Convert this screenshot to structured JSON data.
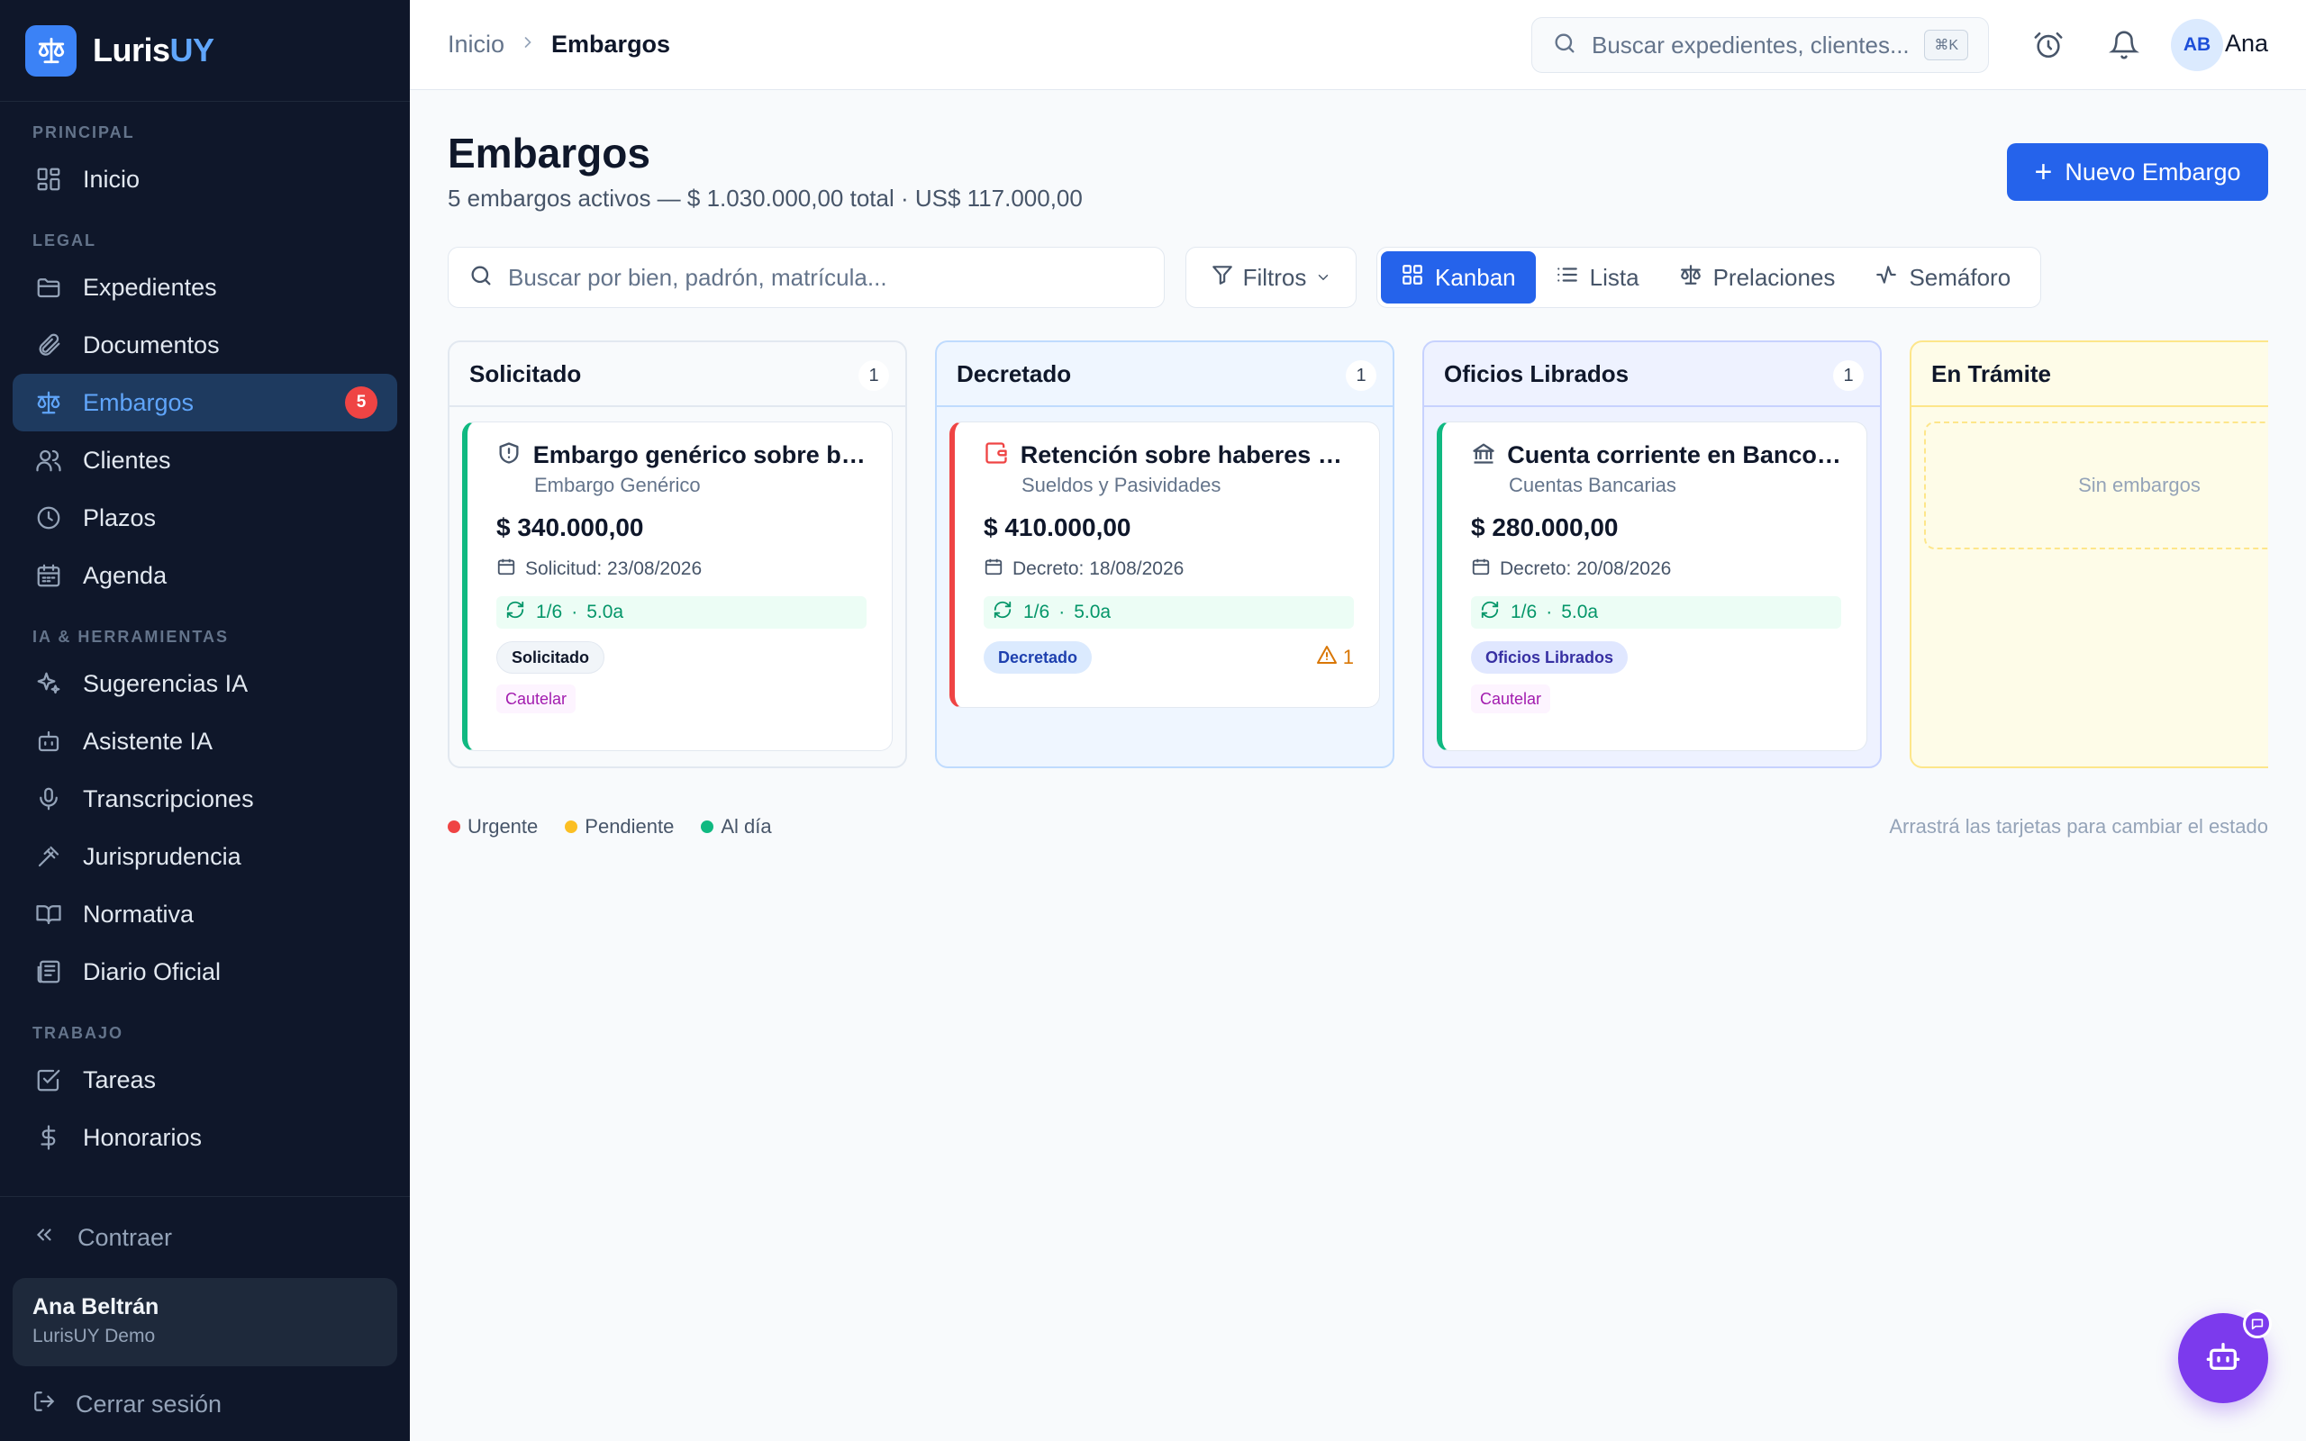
{
  "brand": {
    "name_main": "Luris",
    "name_accent": "UY"
  },
  "sidebar": {
    "sections": [
      {
        "label": "PRINCIPAL",
        "items": [
          {
            "label": "Inicio",
            "icon": "dashboard-icon"
          }
        ]
      },
      {
        "label": "LEGAL",
        "items": [
          {
            "label": "Expedientes",
            "icon": "folder-icon"
          },
          {
            "label": "Documentos",
            "icon": "paperclip-icon"
          },
          {
            "label": "Embargos",
            "icon": "scale-icon",
            "active": true,
            "badge": "5"
          },
          {
            "label": "Clientes",
            "icon": "users-icon"
          },
          {
            "label": "Plazos",
            "icon": "clock-icon"
          },
          {
            "label": "Agenda",
            "icon": "calendar-icon"
          }
        ]
      },
      {
        "label": "IA & HERRAMIENTAS",
        "items": [
          {
            "label": "Sugerencias IA",
            "icon": "sparkles-icon"
          },
          {
            "label": "Asistente IA",
            "icon": "bot-icon"
          },
          {
            "label": "Transcripciones",
            "icon": "mic-icon"
          },
          {
            "label": "Jurisprudencia",
            "icon": "gavel-icon"
          },
          {
            "label": "Normativa",
            "icon": "book-icon"
          },
          {
            "label": "Diario Oficial",
            "icon": "newspaper-icon"
          }
        ]
      },
      {
        "label": "TRABAJO",
        "items": [
          {
            "label": "Tareas",
            "icon": "check-square-icon"
          },
          {
            "label": "Honorarios",
            "icon": "dollar-icon"
          }
        ]
      }
    ],
    "collapse_label": "Contraer",
    "user": {
      "name": "Ana Beltrán",
      "org": "LurisUY Demo"
    },
    "logout_label": "Cerrar sesión"
  },
  "topbar": {
    "breadcrumb": {
      "root": "Inicio",
      "current": "Embargos"
    },
    "search_placeholder": "Buscar expedientes, clientes...",
    "search_shortcut": "⌘K",
    "avatar_initials": "AB",
    "user_short": "Ana"
  },
  "page": {
    "title": "Embargos",
    "subtitle": "5 embargos activos — $ 1.030.000,00 total · US$ 117.000,00",
    "new_button": "Nuevo Embargo",
    "search_placeholder": "Buscar por bien, padrón, matrícula...",
    "filters_label": "Filtros",
    "views": [
      {
        "label": "Kanban",
        "icon": "grid-icon",
        "active": true
      },
      {
        "label": "Lista",
        "icon": "list-icon"
      },
      {
        "label": "Prelaciones",
        "icon": "scale-icon"
      },
      {
        "label": "Semáforo",
        "icon": "activity-icon"
      }
    ]
  },
  "kanban": {
    "columns": [
      {
        "title": "Solicitado",
        "count": "1",
        "card": {
          "title": "Embargo genérico sobre bie...",
          "category": "Embargo Genérico",
          "amount": "$ 340.000,00",
          "date": "Solicitud: 23/08/2026",
          "progress": "1/6",
          "years": "5.0a",
          "status": "Solicitado",
          "tag": "Cautelar"
        }
      },
      {
        "title": "Decretado",
        "count": "1",
        "card": {
          "title": "Retención sobre haberes — ...",
          "category": "Sueldos y Pasividades",
          "amount": "$ 410.000,00",
          "date": "Decreto: 18/08/2026",
          "progress": "1/6",
          "years": "5.0a",
          "status": "Decretado",
          "warnings": "1"
        }
      },
      {
        "title": "Oficios Librados",
        "count": "1",
        "card": {
          "title": "Cuenta corriente en Banco C...",
          "category": "Cuentas Bancarias",
          "amount": "$ 280.000,00",
          "date": "Decreto: 20/08/2026",
          "progress": "1/6",
          "years": "5.0a",
          "status": "Oficios Librados",
          "tag": "Cautelar"
        }
      },
      {
        "title": "En Trámite",
        "empty_label": "Sin embargos"
      }
    ]
  },
  "legend": [
    {
      "label": "Urgente",
      "color": "#ef4444"
    },
    {
      "label": "Pendiente",
      "color": "#fbbf24"
    },
    {
      "label": "Al día",
      "color": "#10b981"
    }
  ],
  "hint": "Arrastrá las tarjetas para cambiar el estado",
  "colors": {
    "accent": "#2563eb",
    "sidebar_bg": "#0f172a",
    "fab": "#7c3aed"
  }
}
